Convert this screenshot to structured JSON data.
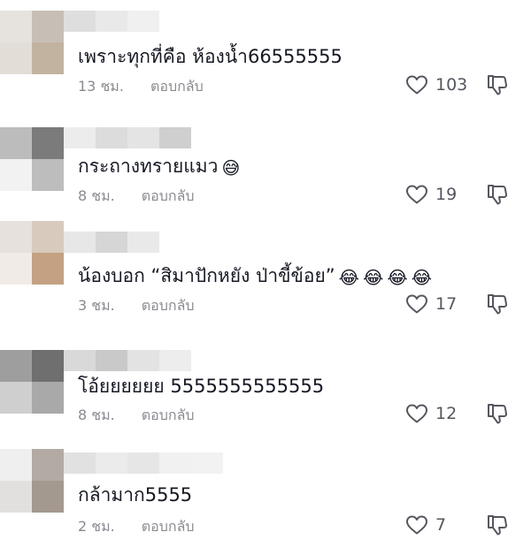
{
  "comments": [
    {
      "avatar": [
        "#e6e2dd",
        "#c7bfb5",
        "#e2ddd7",
        "#c2b3a1"
      ],
      "name_blur": [
        "#dedede",
        "#e9e9e9",
        "#f0f0f0"
      ],
      "text": "เพราะทุกที่คือ ห้องน้ำ66555555",
      "emoji_count": 0,
      "time": "13 ชม.",
      "reply": "ตอบกลับ",
      "likes": "103"
    },
    {
      "avatar": [
        "#bcbcbc",
        "#7b7b7b",
        "#f2f2f2",
        "#bdbdbd"
      ],
      "name_blur": [
        "#ececec",
        "#dcdcdc",
        "#e4e4e4",
        "#cfcfcf"
      ],
      "text": "กระถางทรายแมว",
      "emoji_count": 1,
      "emoji": "😅",
      "time": "8 ชม.",
      "reply": "ตอบกลับ",
      "likes": "19"
    },
    {
      "avatar": [
        "#e6e1dc",
        "#d8cbbd",
        "#f0ebe6",
        "#c4a182"
      ],
      "name_blur": [
        "#e7e7e7",
        "#d6d6d6",
        "#e9e9e9"
      ],
      "text": "น้องบอก “สิมาปักหยัง ป่าขี้ข้อย”",
      "emoji_count": 4,
      "emoji": "😂",
      "time": "3 ชม.",
      "reply": "ตอบกลับ",
      "likes": "17"
    },
    {
      "avatar": [
        "#9e9e9e",
        "#6f6f6f",
        "#cfcfcf",
        "#a9a9a9"
      ],
      "name_blur": [
        "#d9d9d9",
        "#c9c9c9",
        "#e3e3e3",
        "#ededed"
      ],
      "text": "โอ้ยยยยยย 5555555555555",
      "emoji_count": 0,
      "time": "8 ชม.",
      "reply": "ตอบกลับ",
      "likes": "12"
    },
    {
      "avatar": [
        "#f0efef",
        "#b3aaa4",
        "#e2e0de",
        "#a4998f"
      ],
      "name_blur": [
        "#e1e1e1",
        "#ebebeb",
        "#e6e6e6",
        "#f1f1f1",
        "#f2f2f2"
      ],
      "text": "กล้ามาก5555",
      "emoji_count": 0,
      "time": "2 ชม.",
      "reply": "ตอบกลับ",
      "likes": "7"
    }
  ],
  "icons": {
    "like": "heart-outline-icon",
    "dislike": "thumbs-down-outline-icon"
  },
  "colors": {
    "text": "#161823",
    "meta": "#8a8b91",
    "icon": "#55575f"
  }
}
